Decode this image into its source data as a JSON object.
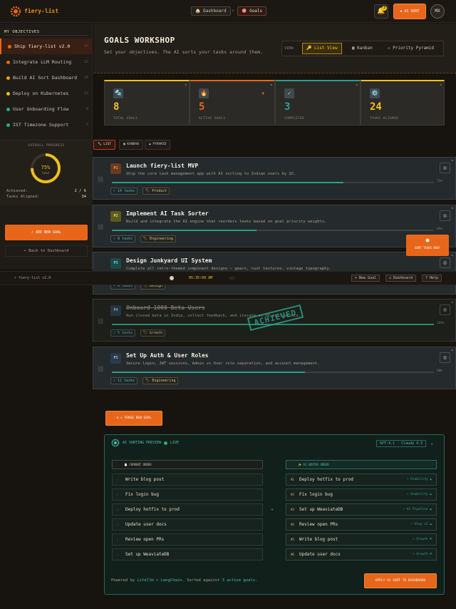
{
  "header": {
    "brand": "fiery-list",
    "crumbs": [
      {
        "label": "🏠 Dashboard"
      },
      {
        "label": "🎯 Goals"
      }
    ],
    "crumb_sep": "›",
    "bell_icon": "🔔",
    "bell_count": "3",
    "ai_sort_label": "✹ AI SORT",
    "avatar": "MX"
  },
  "sidebar": {
    "heading": "MY OBJECTIVES",
    "objectives": [
      {
        "label": "Ship fiery-list v2.0",
        "dot": "#e8661a",
        "count": "10",
        "active": true
      },
      {
        "label": "Integrate LLM Routing",
        "dot": "#e8661a",
        "count": "22"
      },
      {
        "label": "Build AI Sort Dashboard",
        "dot": "#e8a01c",
        "count": "16"
      },
      {
        "label": "Deploy on Kubernetes",
        "dot": "#e8c01c",
        "count": "12"
      },
      {
        "label": "User Onboarding Flow",
        "dot": "#2ab06a",
        "count": "8"
      },
      {
        "label": "IST Timezone Support",
        "dot": "#2ab06a",
        "count": "5"
      }
    ],
    "progress_title": "OVERALL PROGRESS",
    "progress_pct_label": "75%",
    "progress_sub": "Good",
    "progress_value": 0.75,
    "achieved_label": "Achieved:",
    "achieved_value": "2 / 6",
    "aligned_label": "Tasks Aligned:",
    "aligned_value": "34",
    "add_goal": "⚡ ADD NEW GOAL",
    "back": "← Back to Dashboard"
  },
  "hero": {
    "title": "GOALS WORKSHOP",
    "subtitle": "Set your objectives. The AI sorts your tasks around them.",
    "view_label": "VIEW:",
    "views": [
      {
        "label": "🔑 List View",
        "active": true
      },
      {
        "label": "▦ Kanban"
      },
      {
        "label": "⚠ Priority Pyramid"
      }
    ]
  },
  "stats": [
    {
      "icon": "🔩",
      "value": "8",
      "caption": "TOTAL GOALS",
      "color": "#f0c01c"
    },
    {
      "icon": "🔥",
      "value": "5",
      "caption": "ACTIVE GOALS",
      "color": "#e8661a",
      "flag": "▼"
    },
    {
      "icon": "✓",
      "value": "3",
      "caption": "COMPLETED",
      "color": "#2aa08a"
    },
    {
      "icon": "⚙️",
      "value": "24",
      "caption": "TASKS ALIGNED",
      "color": "#f0c01c"
    }
  ],
  "list_tabs": [
    {
      "label": "🔧 LIST",
      "active": true
    },
    {
      "label": "▦ KANBAN"
    },
    {
      "label": "▲ PYRAMID"
    }
  ],
  "goals": [
    {
      "badge": "P1",
      "badge_bg": "#6a3a1c",
      "badge_fg": "#f0a070",
      "title": "Launch fiery-list MVP",
      "desc": "Ship the core task management app with AI sorting to Indian users by Q2.",
      "progress": 0.72,
      "pct": "72%",
      "tasks": "⚡ 14 tasks",
      "category": "🏷 Product"
    },
    {
      "badge": "P2",
      "badge_bg": "#5a5a1c",
      "badge_fg": "#e8e070",
      "title": "Implement AI Task Sorter",
      "desc": "Build and integrate the AI engine that reorders tasks based on goal priority weights.",
      "progress": 0.45,
      "pct": "45%",
      "tasks": "⚡ 8 tasks",
      "category": "🏷 Engineering"
    },
    {
      "badge": "P3",
      "badge_bg": "#1c4a4a",
      "badge_fg": "#70e0d0",
      "title": "Design Junkyard UI System",
      "desc": "Complete all retro-themed component designs — gears, rust textures, vintage typography.",
      "progress": 0.3,
      "pct": "30%",
      "tasks": "⚡ 6 tasks",
      "category": "🏷 Design"
    },
    {
      "badge": "P4",
      "badge_bg": "#2a3a4a",
      "badge_fg": "#a0c0e0",
      "title": "Onboard 1000 Beta Users",
      "desc": "Run closed beta in India, collect feedback, and iterate on UX pain points.",
      "progress": 1.0,
      "pct": "100%",
      "tasks": "⚡ 5 tasks",
      "category": "🏷 Growth",
      "done": true
    },
    {
      "badge": "P5",
      "badge_bg": "#2a3a4a",
      "badge_fg": "#a0c0e0",
      "title": "Set Up Auth & User Roles",
      "desc": "Secure login, JWT sessions, Admin vs User role separation, and account management.",
      "progress": 0.6,
      "pct": "60%",
      "tasks": "⚡ 11 tasks",
      "category": "🏷 Engineering"
    }
  ],
  "achieved_stamp": "ACHIEVED",
  "float_sort": {
    "icon": "✹",
    "label": "SORT TASKS NOW!"
  },
  "strip": {
    "brand": "⚡ fiery-list v2.0",
    "clock": "05:35:09 AM",
    "tz": "IST",
    "buttons": [
      "+ New Goal",
      "⌂ Dashboard",
      "? Help"
    ]
  },
  "add_new_goal": "⚙ + FORGE NEW GOAL",
  "preview": {
    "title": "AI SORTING PREVIEW",
    "live": "LIVE",
    "model": "GPT-4.1 · Claude 4.5",
    "current_head": "📋 CURRENT ORDER",
    "sorted_head": "✨ AI-SORTED ORDER",
    "current": [
      "Write blog post",
      "Fix login bug",
      "Deploy hotfix to prod",
      "Update user docs",
      "Review open PRs",
      "Set up WeaviateDB"
    ],
    "sorted": [
      {
        "n": "#1",
        "t": "Deploy hotfix to prod",
        "r": "→ Stability ▲"
      },
      {
        "n": "#2",
        "t": "Fix login bug",
        "r": "→ Stability ▲"
      },
      {
        "n": "#3",
        "t": "Set up WeaviateDB",
        "r": "→ AI Pipeline ▲"
      },
      {
        "n": "#4",
        "t": "Review open PRs",
        "r": "→ Ship v2 ▲"
      },
      {
        "n": "#5",
        "t": "Write blog post",
        "r": "→ Growth ▼"
      },
      {
        "n": "#6",
        "t": "Update user docs",
        "r": "→ Growth ▼"
      }
    ],
    "footer_pre": "Powered by ",
    "footer_tech": "Litellm + LangChain",
    "footer_mid": ". Sorted against ",
    "footer_goals": "3 active goals",
    "footer_end": ".",
    "apply": "APPLY AI SORT TO DASHBOARD"
  }
}
